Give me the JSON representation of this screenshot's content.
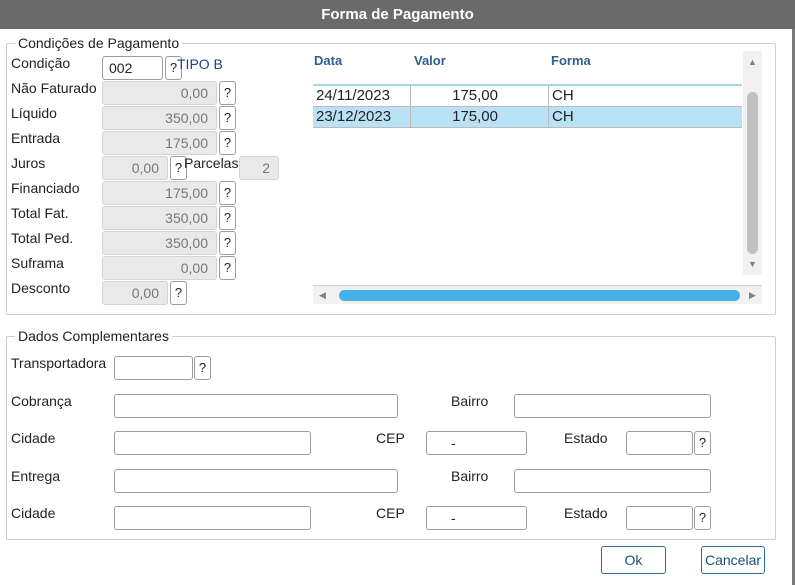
{
  "dialog": {
    "title": "Forma de Pagamento"
  },
  "payment": {
    "legend": "Condições de Pagamento",
    "condicao": {
      "label": "Condição",
      "value": "002",
      "help": "?",
      "tipo": "TIPO B"
    },
    "fields": [
      {
        "label": "Não Faturado",
        "value": "0,00",
        "help": "?"
      },
      {
        "label": "Líquido",
        "value": "350,00",
        "help": "?"
      },
      {
        "label": "Entrada",
        "value": "175,00",
        "help": "?"
      },
      {
        "label": "Juros",
        "value": "0,00",
        "help": "?"
      },
      {
        "label": "Financiado",
        "value": "175,00",
        "help": "?"
      },
      {
        "label": "Total Fat.",
        "value": "350,00",
        "help": "?"
      },
      {
        "label": "Total Ped.",
        "value": "350,00",
        "help": "?"
      },
      {
        "label": "Suframa",
        "value": "0,00",
        "help": "?"
      },
      {
        "label": "Desconto",
        "value": "0,00",
        "help": "?"
      }
    ],
    "parcelas": {
      "label": "Parcelas",
      "value": "2"
    }
  },
  "installments": {
    "columns": [
      "Data",
      "Valor",
      "Forma"
    ],
    "rows": [
      {
        "date": "24/11/2023",
        "value": "175,00",
        "form": "CH",
        "selected": false
      },
      {
        "date": "23/12/2023",
        "value": "175,00",
        "form": "CH",
        "selected": true
      }
    ]
  },
  "complementary": {
    "legend": "Dados Complementares",
    "transportadora": {
      "label": "Transportadora",
      "value": "",
      "help": "?"
    },
    "cobranca": {
      "label": "Cobrança",
      "value": ""
    },
    "cobranca_bairro": {
      "label": "Bairro",
      "value": ""
    },
    "cobranca_cidade": {
      "label": "Cidade",
      "value": ""
    },
    "cobranca_cep": {
      "label": "CEP",
      "value": "-"
    },
    "cobranca_estado": {
      "label": "Estado",
      "value": "",
      "help": "?"
    },
    "entrega": {
      "label": "Entrega",
      "value": ""
    },
    "entrega_bairro": {
      "label": "Bairro",
      "value": ""
    },
    "entrega_cidade": {
      "label": "Cidade",
      "value": ""
    },
    "entrega_cep": {
      "label": "CEP",
      "value": "-"
    },
    "entrega_estado": {
      "label": "Estado",
      "value": "",
      "help": "?"
    }
  },
  "actions": {
    "ok": "Ok",
    "cancel": "Cancelar"
  },
  "icons": {
    "scroll_up": "scroll-up-icon",
    "scroll_down": "scroll-down-icon",
    "scroll_left": "scroll-left-icon",
    "scroll_right": "scroll-right-icon"
  },
  "colors": {
    "titlebar": "#6a6a6a",
    "header_text": "#2d5f8f",
    "tipo_text": "#1f3f96",
    "selected_row": "#b9e2f7",
    "scroll_thumb": "#45b1e8",
    "button_border": "#2e6e9a"
  }
}
